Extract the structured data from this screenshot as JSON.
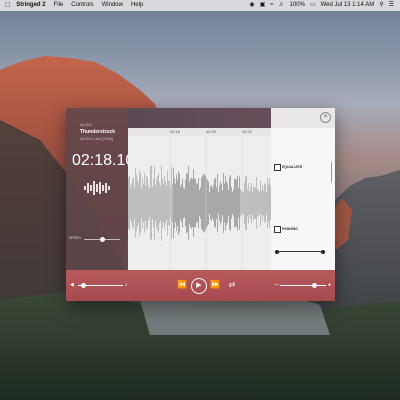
{
  "menubar": {
    "apple_icon": "apple-icon",
    "app_name": "Stringed 2",
    "menus": [
      "File",
      "Controls",
      "Window",
      "Help"
    ],
    "status": {
      "battery": "100%",
      "clock": "Wed Jul 13  1:14 AM"
    }
  },
  "app": {
    "artist": "AC/DC",
    "track": "Thunderstruck",
    "album": "AC/DC Live [2150]",
    "current_time": "02:18.10",
    "speed_label": "SPEED",
    "ruler_ticks": [
      "02:18",
      "02:20",
      "02:22"
    ],
    "right_panel": {
      "equalizer_label": "EQUALIZER",
      "panning_label": "PANNING"
    },
    "transport": {
      "prev_icon": "rewind-icon",
      "play_icon": "play-icon",
      "next_icon": "fast-forward-icon",
      "loop_icon": "loop-icon",
      "playback_position": 0.12,
      "volume_level": 0.75
    }
  }
}
